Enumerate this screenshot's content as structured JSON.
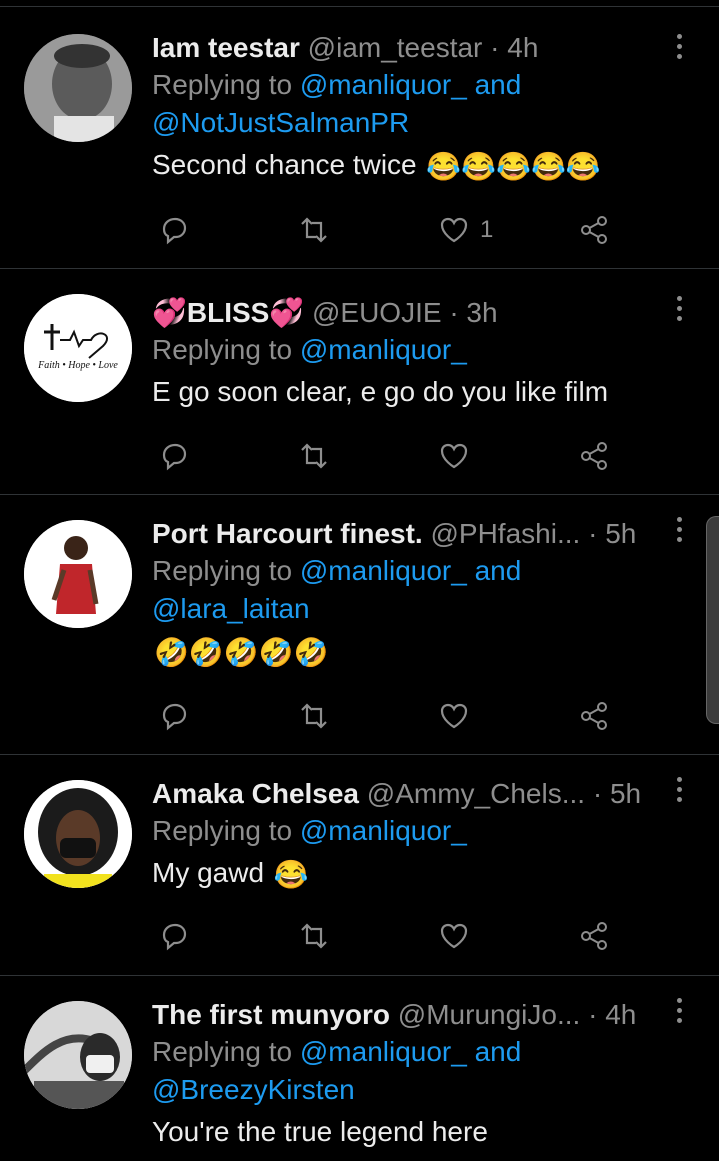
{
  "tweets": [
    {
      "name": "Iam teestar",
      "handle": "@iam_teestar",
      "time": "4h",
      "replying_prefix": "Replying to",
      "mentions_line1": "@manliquor_",
      "and": "and",
      "mentions_line2": "@NotJustSalmanPR",
      "text": "Second chance twice",
      "emoji": "😂😂😂😂😂",
      "like_count": "1"
    },
    {
      "name": "💞BLISS💞",
      "handle": "@EUOJIE",
      "time": "3h",
      "replying_prefix": "Replying to",
      "mentions_line1": "@manliquor_",
      "text": "E go soon clear, e go do you like film",
      "avatar_text": "Faith • Hope • Love"
    },
    {
      "name": "Port Harcourt finest.",
      "handle": "@PHfashi...",
      "time": "5h",
      "replying_prefix": "Replying to",
      "mentions_line1": "@manliquor_",
      "and": "and",
      "mentions_line2": "@lara_laitan",
      "emoji": "🤣🤣🤣🤣🤣"
    },
    {
      "name": "Amaka Chelsea",
      "handle": "@Ammy_Chels...",
      "time": "5h",
      "replying_prefix": "Replying to",
      "mentions_line1": "@manliquor_",
      "text": "My gawd",
      "emoji": "😂"
    },
    {
      "name": "The first munyoro",
      "handle": "@MurungiJo...",
      "time": "4h",
      "replying_prefix": "Replying to",
      "mentions_line1": "@manliquor_",
      "and": "and",
      "mentions_line2": "@BreezyKirsten",
      "text": "You're the true legend here"
    }
  ],
  "icons": {
    "reply": "reply-icon",
    "retweet": "retweet-icon",
    "like": "heart-icon",
    "share": "share-icon",
    "more": "more-vertical-icon"
  },
  "colors": {
    "background": "#000000",
    "name": "#ececec",
    "meta": "#8e8e8e",
    "mention": "#1d9bf0",
    "divider": "#2f3336"
  }
}
